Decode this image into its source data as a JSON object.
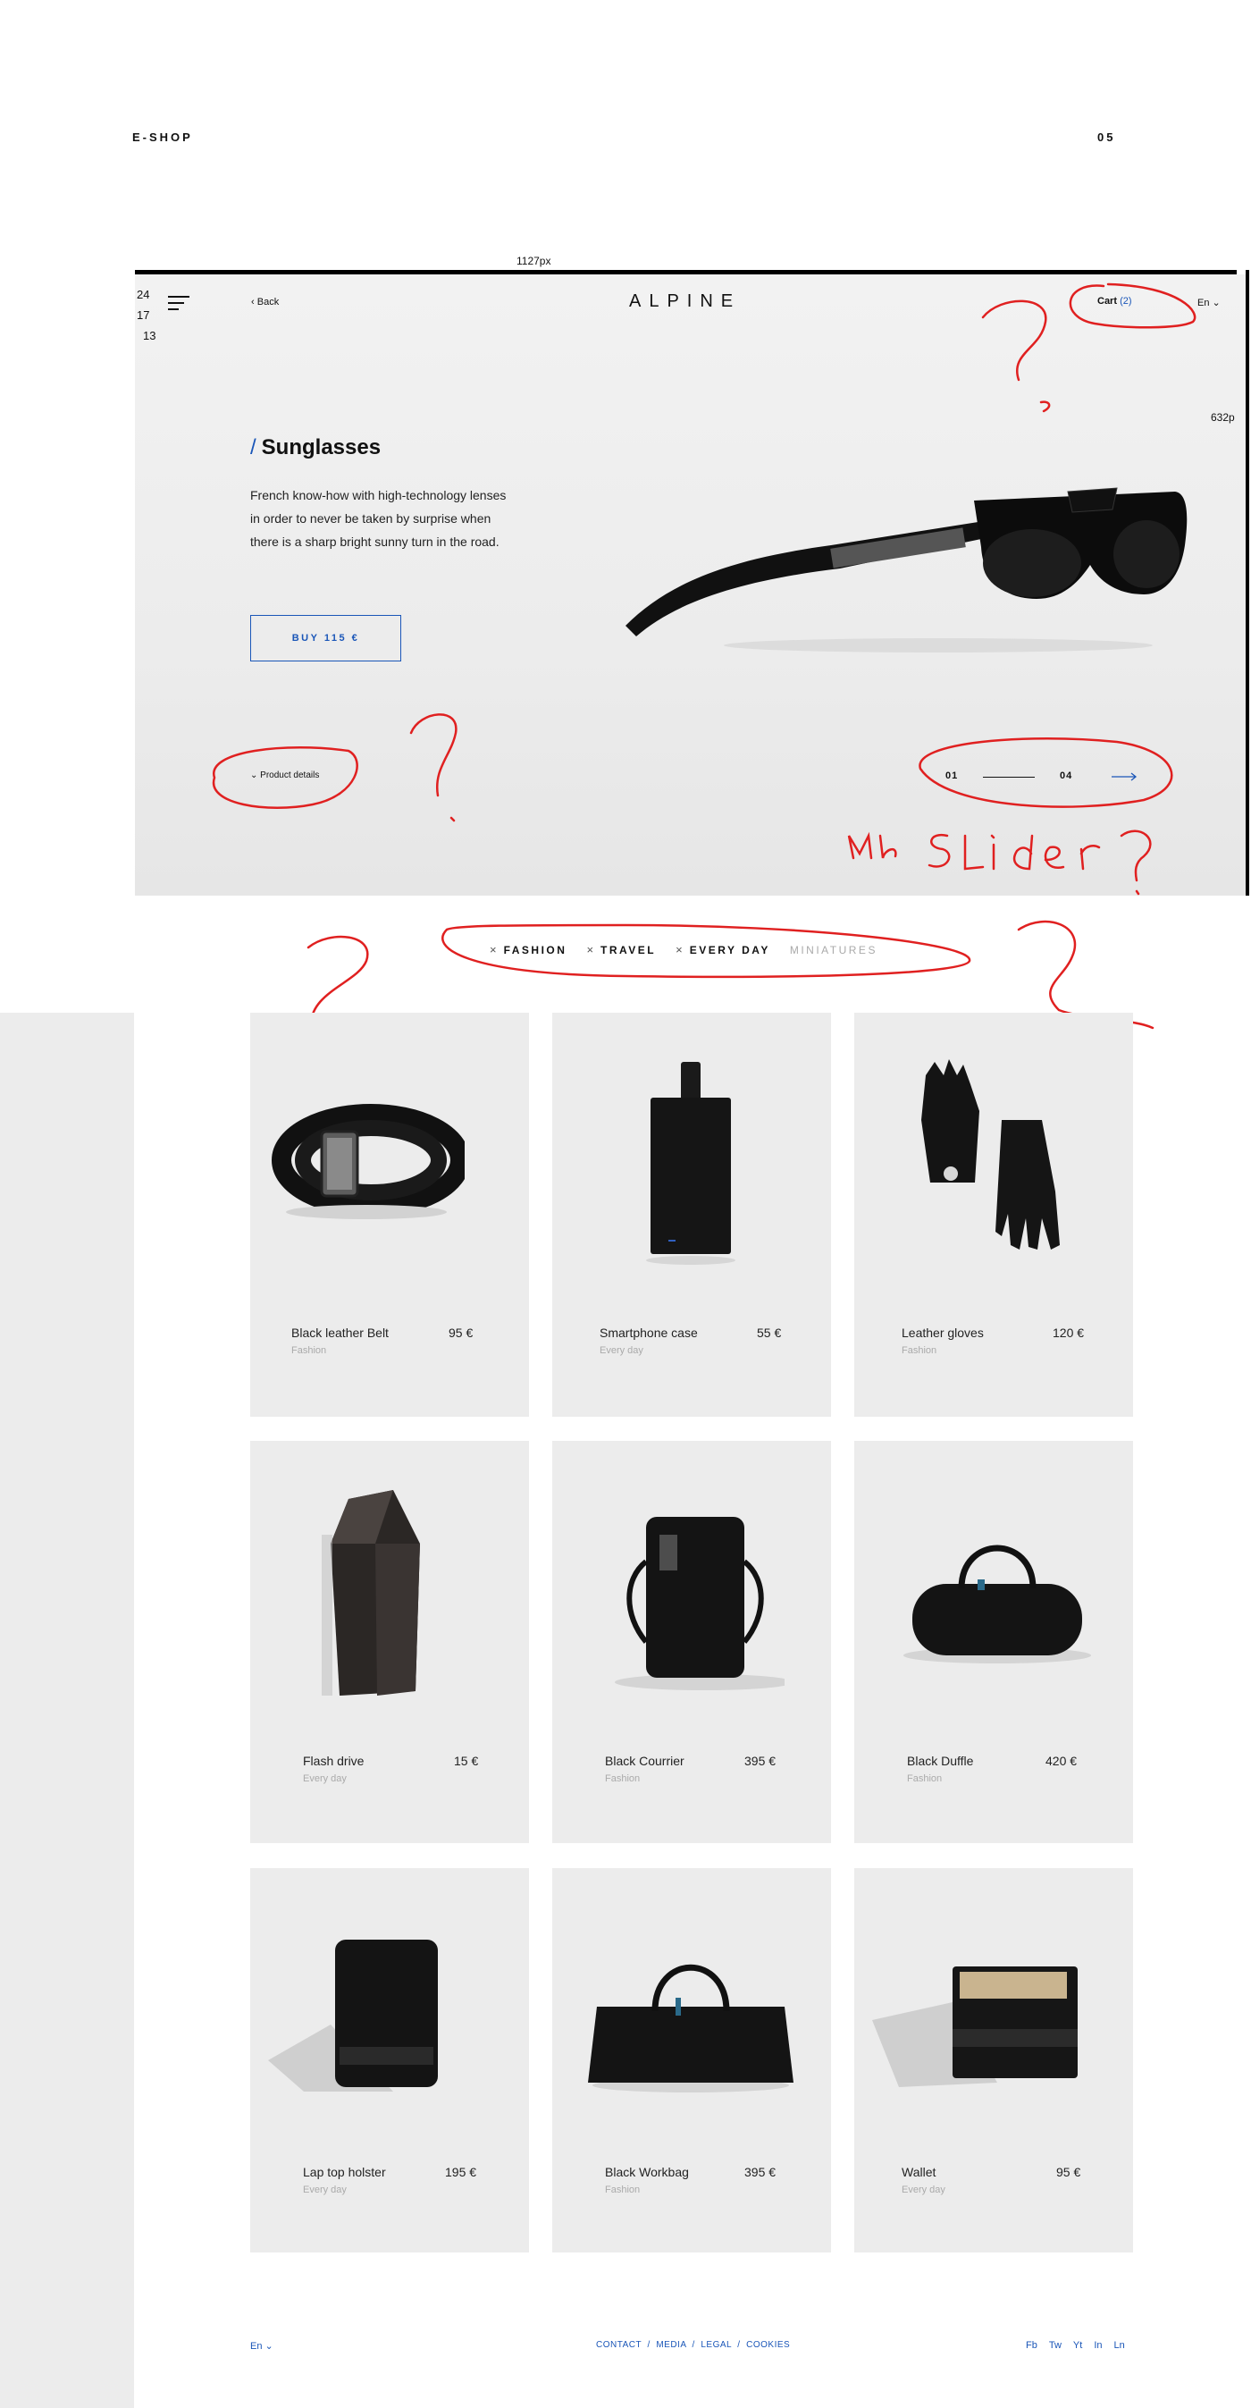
{
  "page": {
    "title": "E-SHOP",
    "number": "05"
  },
  "annotations": {
    "width_label": "1127px",
    "height_label": "632p",
    "side_numbers": [
      "24",
      "17",
      "13"
    ],
    "slider_note": "mb SLider?"
  },
  "header": {
    "back_label": "Back",
    "logo": "ALPINE",
    "cart_label": "Cart",
    "cart_count": "(2)",
    "language": "En"
  },
  "hero": {
    "title": "Sunglasses",
    "description": "French know-how with high-technology lenses in order to never be taken by surprise when there is a sharp bright sunny turn in the road.",
    "buy_label": "BUY 115 €",
    "details_label": "Product details",
    "slider_current": "01",
    "slider_total": "04"
  },
  "filters": [
    {
      "label": "FASHION",
      "active": true
    },
    {
      "label": "TRAVEL",
      "active": true
    },
    {
      "label": "EVERY DAY",
      "active": true
    },
    {
      "label": "MINIATURES",
      "active": false
    }
  ],
  "products": [
    {
      "name": "Black leather Belt",
      "price": "95 €",
      "category": "Fashion",
      "icon": "belt-icon"
    },
    {
      "name": "Smartphone case",
      "price": "55 €",
      "category": "Every day",
      "icon": "phone-case-icon"
    },
    {
      "name": "Leather gloves",
      "price": "120 €",
      "category": "Fashion",
      "icon": "gloves-icon"
    },
    {
      "name": "Flash drive",
      "price": "15 €",
      "category": "Every day",
      "icon": "flash-drive-icon"
    },
    {
      "name": "Black Courrier",
      "price": "395 €",
      "category": "Fashion",
      "icon": "messenger-bag-icon"
    },
    {
      "name": "Black Duffle",
      "price": "420 €",
      "category": "Fashion",
      "icon": "duffle-bag-icon"
    },
    {
      "name": "Lap top holster",
      "price": "195 €",
      "category": "Every day",
      "icon": "laptop-sleeve-icon"
    },
    {
      "name": "Black Workbag",
      "price": "395 €",
      "category": "Fashion",
      "icon": "workbag-icon"
    },
    {
      "name": "Wallet",
      "price": "95 €",
      "category": "Every day",
      "icon": "wallet-icon"
    }
  ],
  "footer": {
    "language": "En",
    "links": [
      "CONTACT",
      "MEDIA",
      "LEGAL",
      "COOKIES"
    ],
    "social": [
      "Fb",
      "Tw",
      "Yt",
      "In",
      "Ln"
    ]
  },
  "colors": {
    "accent": "#1a56b8",
    "card_bg": "#ececec",
    "annotation_red": "#e02020"
  }
}
